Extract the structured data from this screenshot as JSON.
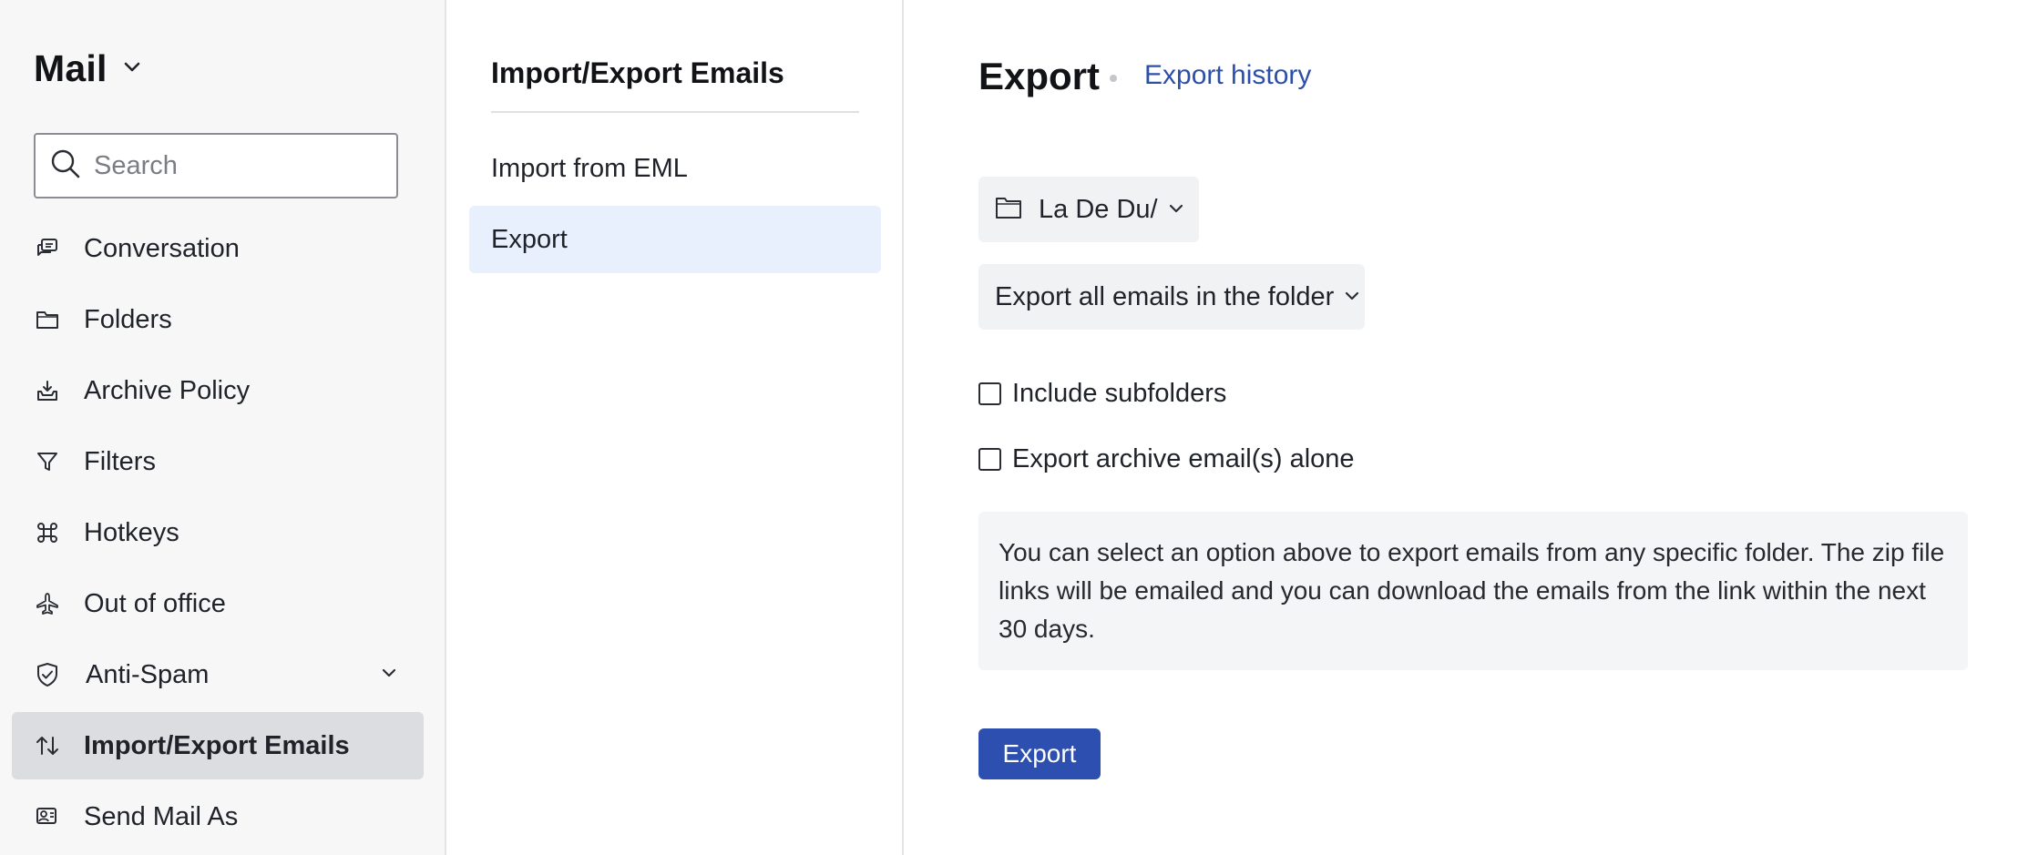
{
  "sidebar": {
    "app_title": "Mail",
    "search": {
      "placeholder": "Search",
      "value": ""
    },
    "items": [
      {
        "label": "Conversation",
        "icon": "conversation-icon"
      },
      {
        "label": "Folders",
        "icon": "folder-icon"
      },
      {
        "label": "Archive Policy",
        "icon": "archive-icon"
      },
      {
        "label": "Filters",
        "icon": "filter-icon"
      },
      {
        "label": "Hotkeys",
        "icon": "command-key-icon"
      },
      {
        "label": "Out of office",
        "icon": "airplane-icon"
      },
      {
        "label": "Anti-Spam",
        "icon": "shield-check-icon"
      },
      {
        "label": "Import/Export Emails",
        "icon": "swap-arrows-icon",
        "active": true
      },
      {
        "label": "Send Mail As",
        "icon": "send-as-icon"
      }
    ]
  },
  "middle": {
    "title": "Import/Export Emails",
    "items": [
      {
        "label": "Import from EML"
      },
      {
        "label": "Export",
        "active": true
      }
    ]
  },
  "main": {
    "title": "Export",
    "history_link": "Export history",
    "folder_selector": "La De Du/",
    "scope_selector": "Export all emails in the folder",
    "checkboxes": [
      {
        "label": "Include subfolders",
        "checked": false
      },
      {
        "label": "Export archive email(s) alone",
        "checked": false
      }
    ],
    "info_text": "You can select an option above to export emails from any specific folder. The zip file links will be emailed and you can download the emails from the link within the next 30 days.",
    "export_button": "Export"
  },
  "colors": {
    "accent": "#2d4fb0",
    "link": "#2c4fa8",
    "active_nav_bg": "#dcdde1",
    "active_mid_bg": "#e8effd"
  }
}
